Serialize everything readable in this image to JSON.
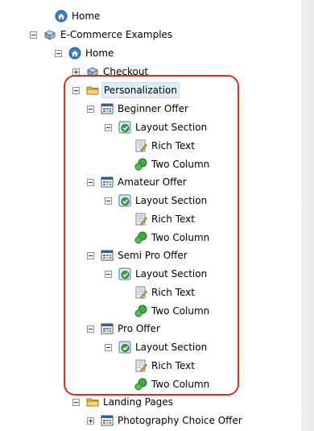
{
  "tree": {
    "nodes": [
      {
        "label": "Home",
        "icon": "home-icon",
        "expander": "none",
        "selected": false
      },
      {
        "label": "E-Commerce Examples",
        "icon": "cube-stack-icon",
        "expander": "minus",
        "selected": false
      },
      {
        "label": "Home",
        "icon": "home-icon",
        "expander": "minus",
        "selected": false
      },
      {
        "label": "Checkout",
        "icon": "cube-stack-icon",
        "expander": "plus",
        "selected": false
      },
      {
        "label": "Personalization",
        "icon": "folder-icon",
        "expander": "minus",
        "selected": true
      },
      {
        "label": "Beginner Offer",
        "icon": "grid-page-icon",
        "expander": "minus",
        "selected": false
      },
      {
        "label": "Layout Section",
        "icon": "check-document-icon",
        "expander": "minus",
        "selected": false
      },
      {
        "label": "Rich Text",
        "icon": "edit-document-icon",
        "expander": "none",
        "selected": false
      },
      {
        "label": "Two Column",
        "icon": "green-puzzle-icon",
        "expander": "none",
        "selected": false
      },
      {
        "label": "Amateur Offer",
        "icon": "grid-page-icon",
        "expander": "minus",
        "selected": false
      },
      {
        "label": "Layout Section",
        "icon": "check-document-icon",
        "expander": "minus",
        "selected": false
      },
      {
        "label": "Rich Text",
        "icon": "edit-document-icon",
        "expander": "none",
        "selected": false
      },
      {
        "label": "Two Column",
        "icon": "green-puzzle-icon",
        "expander": "none",
        "selected": false
      },
      {
        "label": "Semi Pro Offer",
        "icon": "grid-page-icon",
        "expander": "minus",
        "selected": false
      },
      {
        "label": "Layout Section",
        "icon": "check-document-icon",
        "expander": "minus",
        "selected": false
      },
      {
        "label": "Rich Text",
        "icon": "edit-document-icon",
        "expander": "none",
        "selected": false
      },
      {
        "label": "Two Column",
        "icon": "green-puzzle-icon",
        "expander": "none",
        "selected": false
      },
      {
        "label": "Pro Offer",
        "icon": "grid-page-icon",
        "expander": "minus",
        "selected": false
      },
      {
        "label": "Layout Section",
        "icon": "check-document-icon",
        "expander": "minus",
        "selected": false
      },
      {
        "label": "Rich Text",
        "icon": "edit-document-icon",
        "expander": "none",
        "selected": false
      },
      {
        "label": "Two Column",
        "icon": "green-puzzle-icon",
        "expander": "none",
        "selected": false
      },
      {
        "label": "Landing Pages",
        "icon": "folder-icon",
        "expander": "minus",
        "selected": false
      },
      {
        "label": "Photography Choice Offer",
        "icon": "grid-page-icon",
        "expander": "plus",
        "selected": false
      }
    ]
  },
  "annotation": {
    "color": "#e8291a"
  }
}
